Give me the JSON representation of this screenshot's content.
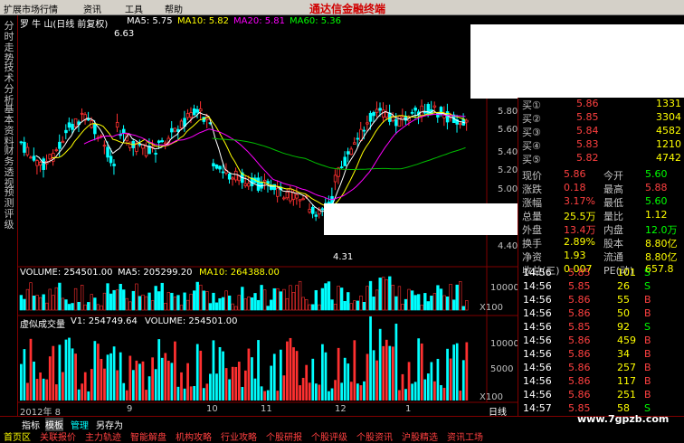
{
  "menu": {
    "items": [
      "扩展市场行情",
      "资讯",
      "工具",
      "帮助"
    ],
    "brand": "通达信金融终端"
  },
  "chart_header": {
    "stock": "罗 牛 山(日线 前复权)",
    "ma5": "MA5: 5.75",
    "ma10": "MA10: 5.82",
    "ma20": "MA20: 5.81",
    "ma60": "MA60: 5.36"
  },
  "left_tabs": [
    "分时走势",
    "技术分析",
    "基本资料",
    "财务透视",
    "预测评级"
  ],
  "price_annotations": {
    "high": "6.63",
    "low": "4.31"
  },
  "price_axis": [
    "5.80",
    "5.60",
    "5.40",
    "5.20",
    "5.00",
    "4.40"
  ],
  "volume_header": {
    "volume": "VOLUME: 254501.00",
    "ma5": "MA5: 205299.20",
    "ma10": "MA10: 264388.00"
  },
  "volume_axis": [
    "10000",
    "X100"
  ],
  "virtual_header": {
    "title": "虚似成交量",
    "v1": "V1: 254749.64",
    "volume": "VOLUME: 254501.00"
  },
  "virtual_axis": [
    "10000",
    "5000",
    "X100"
  ],
  "date_axis": [
    "2012年 8",
    "9",
    "10",
    "11",
    "12",
    "1"
  ],
  "period": "日线",
  "bottom_tabs": [
    "指标",
    "模板",
    "管理",
    "另存为"
  ],
  "bottom_nav": [
    "首页区",
    "关联报价",
    "主力轨迹",
    "智能解盘",
    "机构攻略",
    "行业攻略",
    "个股研报",
    "个股评级",
    "个股资讯",
    "沪股精选",
    "资讯工场"
  ],
  "order_book": [
    {
      "label": "买①",
      "price": "5.86",
      "vol": "1331"
    },
    {
      "label": "买②",
      "price": "5.85",
      "vol": "3304"
    },
    {
      "label": "买③",
      "price": "5.84",
      "vol": "4582"
    },
    {
      "label": "买④",
      "price": "5.83",
      "vol": "1210"
    },
    {
      "label": "买⑤",
      "price": "5.82",
      "vol": "4742"
    }
  ],
  "quote": [
    {
      "l1": "现价",
      "v1": "5.86",
      "l2": "今开",
      "v2": "5.60"
    },
    {
      "l1": "涨跌",
      "v1": "0.18",
      "l2": "最高",
      "v2": "5.88"
    },
    {
      "l1": "涨幅",
      "v1": "3.17%",
      "l2": "最低",
      "v2": "5.60"
    },
    {
      "l1": "总量",
      "v1": "25.5万",
      "l2": "量比",
      "v2": "1.12"
    },
    {
      "l1": "外盘",
      "v1": "13.4万",
      "l2": "内盘",
      "v2": "12.0万"
    },
    {
      "l1": "换手",
      "v1": "2.89%",
      "l2": "股本",
      "v2": "8.80亿"
    },
    {
      "l1": "净资",
      "v1": "1.93",
      "l2": "流通",
      "v2": "8.80亿"
    },
    {
      "l1": "收益(三)",
      "v1": "0.007",
      "l2": "PE(动)",
      "v2": "657.8"
    }
  ],
  "ticks": [
    {
      "t": "14:56",
      "p": "5.85",
      "v": "101",
      "d": "S"
    },
    {
      "t": "14:56",
      "p": "5.85",
      "v": "26",
      "d": "S"
    },
    {
      "t": "14:56",
      "p": "5.86",
      "v": "55",
      "d": "B"
    },
    {
      "t": "14:56",
      "p": "5.86",
      "v": "50",
      "d": "B"
    },
    {
      "t": "14:56",
      "p": "5.85",
      "v": "92",
      "d": "S"
    },
    {
      "t": "14:56",
      "p": "5.86",
      "v": "459",
      "d": "B"
    },
    {
      "t": "14:56",
      "p": "5.86",
      "v": "34",
      "d": "B"
    },
    {
      "t": "14:56",
      "p": "5.86",
      "v": "257",
      "d": "B"
    },
    {
      "t": "14:56",
      "p": "5.86",
      "v": "117",
      "d": "B"
    },
    {
      "t": "14:56",
      "p": "5.86",
      "v": "251",
      "d": "B"
    },
    {
      "t": "14:57",
      "p": "5.85",
      "v": "58",
      "d": "S"
    }
  ],
  "watermark": "www.7gpzb.com"
}
